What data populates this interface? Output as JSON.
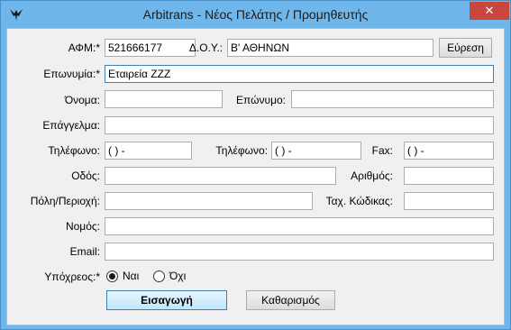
{
  "window": {
    "title": "Arbitrans - Νέος Πελάτης / Προμηθευτής",
    "close_glyph": "✕"
  },
  "form": {
    "afm": {
      "label": "ΑΦΜ:*",
      "value": "521666177"
    },
    "doy": {
      "label": "Δ.Ο.Υ.:",
      "value": "Β' ΑΘΗΝΩΝ"
    },
    "search_button": "Εύρεση",
    "company": {
      "label": "Επωνυμία:*",
      "value": "Εταιρεία ZZZ"
    },
    "first_name": {
      "label": "Όνομα:",
      "value": ""
    },
    "last_name": {
      "label": "Επώνυμο:",
      "value": ""
    },
    "profession": {
      "label": "Επάγγελμα:",
      "value": ""
    },
    "phone1": {
      "label": "Τηλέφωνο:",
      "value": "(  )   -"
    },
    "phone2": {
      "label": "Τηλέφωνο:",
      "value": "(  )   -"
    },
    "fax": {
      "label": "Fax:",
      "value": "(  )   -"
    },
    "street": {
      "label": "Οδός:",
      "value": ""
    },
    "number": {
      "label": "Αριθμός:",
      "value": ""
    },
    "city": {
      "label": "Πόλη/Περιοχή:",
      "value": ""
    },
    "postal": {
      "label": "Ταχ. Κώδικας:",
      "value": ""
    },
    "prefecture": {
      "label": "Νομός:",
      "value": ""
    },
    "email": {
      "label": "Email:",
      "value": ""
    },
    "obliged": {
      "label": "Υπόχρεος:*",
      "options": [
        "Ναι",
        "Όχι"
      ],
      "selected": "Ναι"
    },
    "insert_button": "Εισαγωγή",
    "clear_button": "Καθαρισμός"
  }
}
